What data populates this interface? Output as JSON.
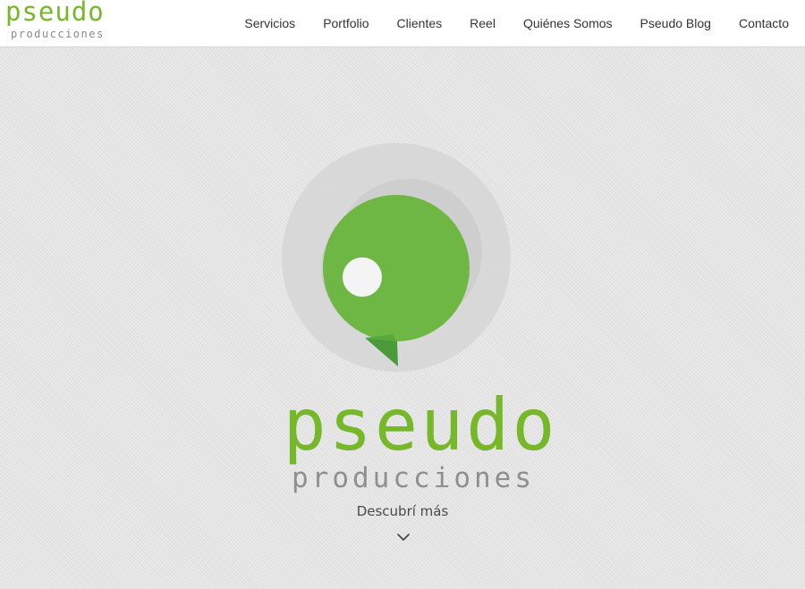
{
  "brand": {
    "name": "pseudo",
    "tagline": "producciones"
  },
  "nav": {
    "items": [
      {
        "label": "Servicios"
      },
      {
        "label": "Portfolio"
      },
      {
        "label": "Clientes"
      },
      {
        "label": "Reel"
      },
      {
        "label": "Quiénes Somos"
      },
      {
        "label": "Pseudo Blog"
      },
      {
        "label": "Contacto"
      }
    ]
  },
  "hero": {
    "title": "pseudo",
    "subtitle": "producciones",
    "cta_label": "Descubrí más",
    "cta_icon": "chevron-down-icon"
  },
  "colors": {
    "brand_green": "#76b82a",
    "dark_green": "#4a9a3a",
    "gray_text": "#8f8f8f",
    "nav_text": "#333333"
  }
}
